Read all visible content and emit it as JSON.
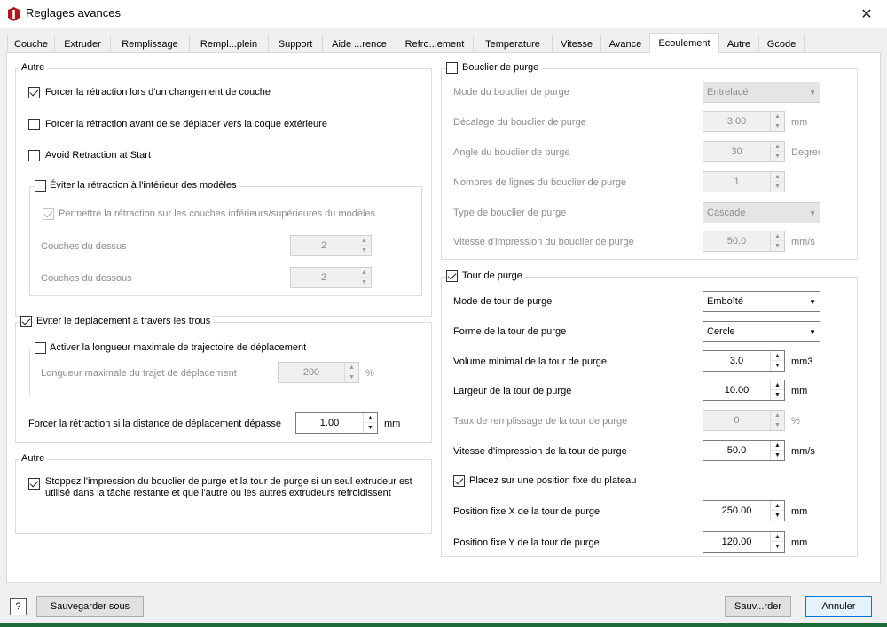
{
  "window": {
    "title": "Reglages avances",
    "close_glyph": "✕"
  },
  "tabs": [
    {
      "label": "Couche"
    },
    {
      "label": "Extruder"
    },
    {
      "label": "Remplissage"
    },
    {
      "label": "Rempl...plein"
    },
    {
      "label": "Support"
    },
    {
      "label": "Aide ...rence"
    },
    {
      "label": "Refro...ement"
    },
    {
      "label": "Temperature"
    },
    {
      "label": "Vitesse"
    },
    {
      "label": "Avance"
    },
    {
      "label": "Ecoulement",
      "active": true
    },
    {
      "label": "Autre"
    },
    {
      "label": "Gcode"
    }
  ],
  "left": {
    "autre1": {
      "title": "Autre",
      "force_layer_change": "Forcer la rétraction lors d'un changement de couche",
      "force_before_outer": "Forcer la rétraction avant de se déplacer vers la coque extérieure",
      "avoid_at_start": "Avoid Retraction at Start",
      "inside_models": {
        "title": "Éviter la rétraction à l'intérieur des modèles",
        "allow_top_bottom": "Permettre la rétraction sur les couches inférieurs/supérieures du modèles",
        "top_layers_label": "Couches du dessus",
        "top_layers_value": "2",
        "bottom_layers_label": "Couches du dessous",
        "bottom_layers_value": "2"
      }
    },
    "avoid_holes": {
      "title": "Eviter le deplacement a travers les trous",
      "max_length": {
        "title": "Activer la longueur maximale de trajectoire de déplacement",
        "label": "Longueur maximale du trajet de déplacement",
        "value": "200",
        "unit": "%"
      },
      "force_distance_label": "Forcer la rétraction si la distance de déplacement dépasse",
      "force_distance_value": "1.00",
      "force_distance_unit": "mm"
    },
    "autre2": {
      "title": "Autre",
      "stop_text_line1": "Stoppez l'impression du bouclier de purge et la tour de purge si un seul extrudeur est",
      "stop_text_line2": "utilisé dans la tâche restante et que l'autre ou les autres extrudeurs refroidissent"
    }
  },
  "right": {
    "shield": {
      "title": "Bouclier de purge",
      "rows": [
        {
          "label": "Mode du bouclier de purge",
          "kind": "combo",
          "value": "Entrelacé"
        },
        {
          "label": "Décalage du bouclier de purge",
          "kind": "spin",
          "value": "3.00",
          "unit": "mm"
        },
        {
          "label": "Angle du bouclier de purge",
          "kind": "spin",
          "value": "30",
          "unit": "Degres"
        },
        {
          "label": "Nombres de lignes du bouclier de purge",
          "kind": "spin",
          "value": "1",
          "unit": ""
        },
        {
          "label": "Type de bouclier de purge",
          "kind": "combo",
          "value": "Cascade"
        },
        {
          "label": "Vitesse d'impression du bouclier de purge",
          "kind": "spin",
          "value": "50.0",
          "unit": "mm/s"
        }
      ]
    },
    "tower": {
      "title": "Tour de purge",
      "mode_label": "Mode de tour de purge",
      "mode_value": "Emboîté",
      "shape_label": "Forme de la tour de purge",
      "shape_value": "Cercle",
      "min_vol_label": "Volume minimal de la tour de purge",
      "min_vol_value": "3.0",
      "min_vol_unit": "mm3",
      "width_label": "Largeur de la tour de purge",
      "width_value": "10.00",
      "width_unit": "mm",
      "fill_label": "Taux de remplissage de la tour de purge",
      "fill_value": "0",
      "fill_unit": "%",
      "speed_label": "Vitesse d'impression de la tour de purge",
      "speed_value": "50.0",
      "speed_unit": "mm/s",
      "fixed_pos_label": "Placez sur une position fixe du plateau",
      "pos_x_label": "Position fixe X de la tour de purge",
      "pos_x_value": "250.00",
      "pos_x_unit": "mm",
      "pos_y_label": "Position fixe Y de la tour de purge",
      "pos_y_value": "120.00",
      "pos_y_unit": "mm"
    }
  },
  "footer": {
    "help": "?",
    "save_as": "Sauvegarder sous",
    "save": "Sauv...rder",
    "cancel": "Annuler"
  }
}
